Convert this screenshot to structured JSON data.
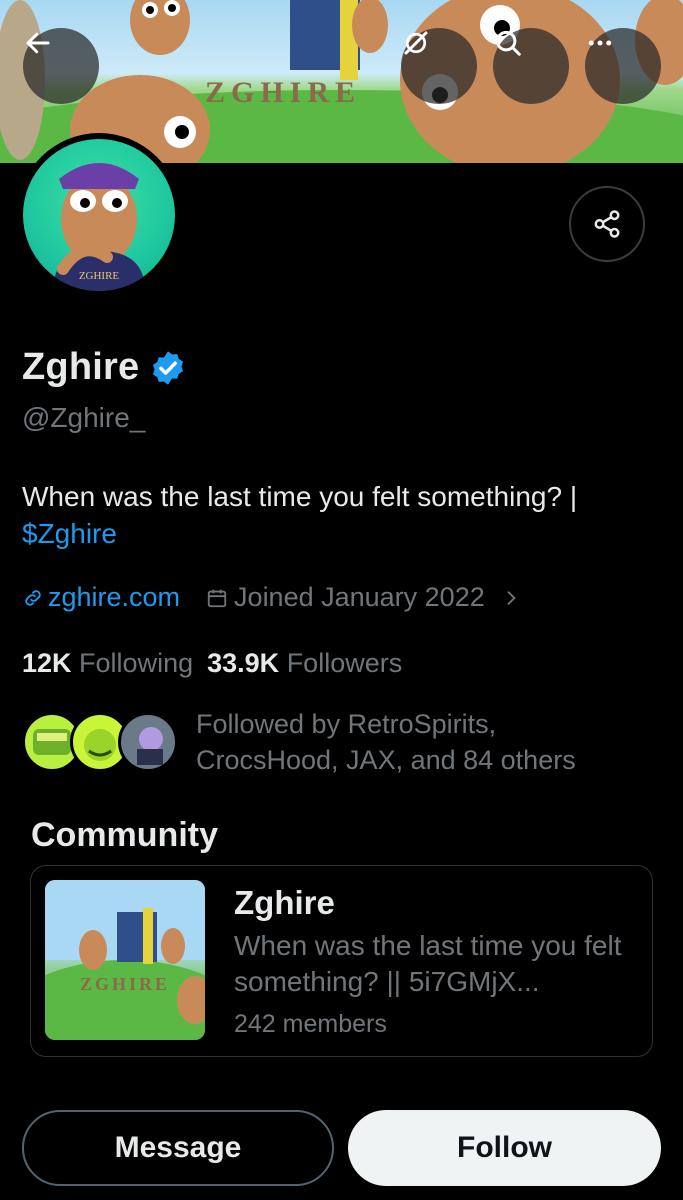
{
  "header": {
    "banner_text": "ZGHIRE",
    "back_icon": "arrow-left-icon",
    "grok_icon": "grok-icon",
    "search_icon": "search-icon",
    "more_icon": "more-horizontal-icon"
  },
  "profile": {
    "avatar_text": "ZGHIRE",
    "display_name": "Zghire",
    "verified_icon": "verified-badge-icon",
    "handle": "@Zghire_",
    "bio_text": "When was the last time you felt something? |",
    "bio_cashtag": "$Zghire",
    "website": "zghire.com",
    "joined": "Joined January 2022",
    "following_count": "12K",
    "following_label": "Following",
    "followers_count": "33.9K",
    "followers_label": "Followers",
    "followed_by": "Followed by RetroSpirits, CrocsHood, JAX, and 84 others"
  },
  "community": {
    "section_title": "Community",
    "name": "Zghire",
    "description": "When was the last time you felt something? || 5i7GMjX...",
    "members": "242 members",
    "thumb_text": "ZGHIRE"
  },
  "actions": {
    "message_label": "Message",
    "follow_label": "Follow"
  },
  "colors": {
    "accent": "#1d9bf0",
    "background": "#000000",
    "secondary_text": "#71767b"
  }
}
